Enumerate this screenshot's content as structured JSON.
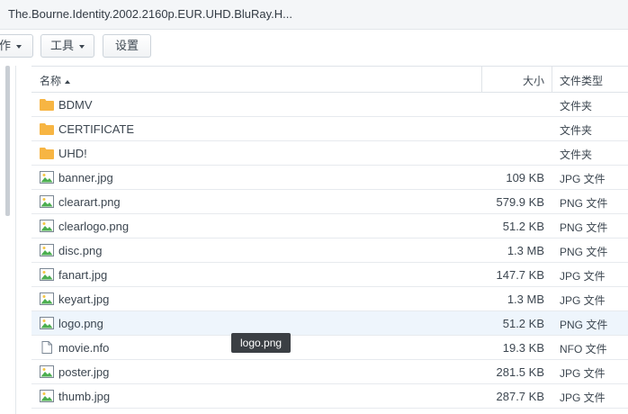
{
  "window": {
    "title": "The.Bourne.Identity.2002.2160p.EUR.UHD.BluRay.H..."
  },
  "toolbar": {
    "action_label": "作",
    "tools_label": "工具",
    "settings_label": "设置"
  },
  "list": {
    "columns": {
      "name": "名称",
      "size": "大小",
      "type": "文件类型"
    },
    "rows": [
      {
        "name": "BDMV",
        "size": "",
        "type": "文件夹",
        "icon": "folder-icon"
      },
      {
        "name": "CERTIFICATE",
        "size": "",
        "type": "文件夹",
        "icon": "folder-icon"
      },
      {
        "name": "UHD!",
        "size": "",
        "type": "文件夹",
        "icon": "folder-icon"
      },
      {
        "name": "banner.jpg",
        "size": "109 KB",
        "type": "JPG 文件",
        "icon": "image-file-icon"
      },
      {
        "name": "clearart.png",
        "size": "579.9 KB",
        "type": "PNG 文件",
        "icon": "image-file-icon"
      },
      {
        "name": "clearlogo.png",
        "size": "51.2 KB",
        "type": "PNG 文件",
        "icon": "image-file-icon"
      },
      {
        "name": "disc.png",
        "size": "1.3 MB",
        "type": "PNG 文件",
        "icon": "image-file-icon"
      },
      {
        "name": "fanart.jpg",
        "size": "147.7 KB",
        "type": "JPG 文件",
        "icon": "image-file-icon"
      },
      {
        "name": "keyart.jpg",
        "size": "1.3 MB",
        "type": "JPG 文件",
        "icon": "image-file-icon"
      },
      {
        "name": "logo.png",
        "size": "51.2 KB",
        "type": "PNG 文件",
        "icon": "image-file-icon",
        "selected": true
      },
      {
        "name": "movie.nfo",
        "size": "19.3 KB",
        "type": "NFO 文件",
        "icon": "document-file-icon"
      },
      {
        "name": "poster.jpg",
        "size": "281.5 KB",
        "type": "JPG 文件",
        "icon": "image-file-icon"
      },
      {
        "name": "thumb.jpg",
        "size": "287.7 KB",
        "type": "JPG 文件",
        "icon": "image-file-icon"
      }
    ]
  },
  "tooltip": {
    "text": "logo.png"
  },
  "colors": {
    "folder": "#f7b543",
    "image_frame": "#7b8794",
    "image_hill": "#4caf50",
    "selected_row": "#eef5fc",
    "tooltip_bg": "#3b3f44"
  }
}
